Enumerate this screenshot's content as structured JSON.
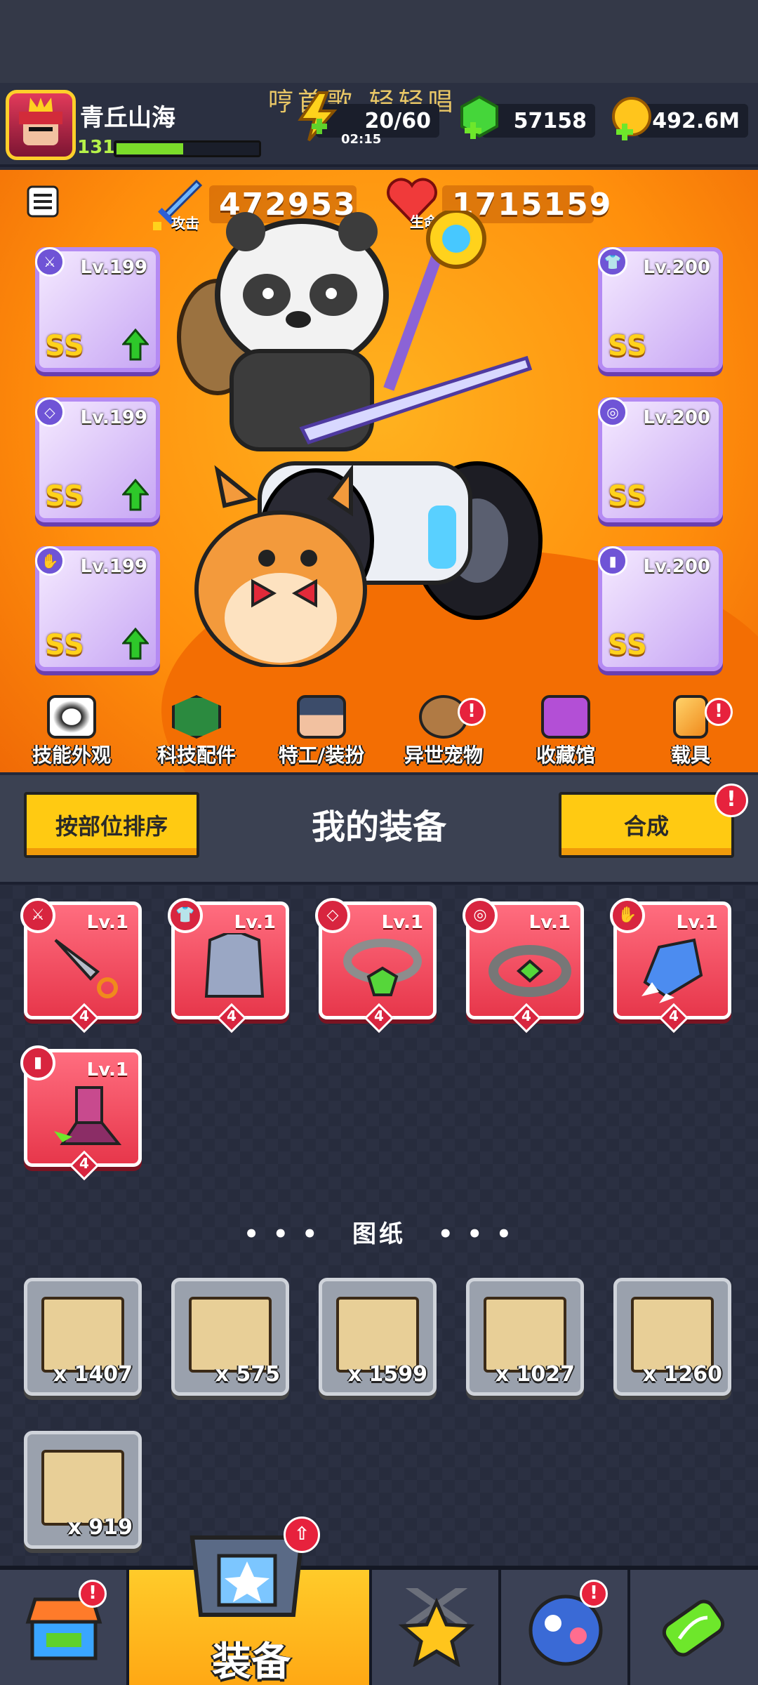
{
  "header": {
    "player_name": "青丘山海",
    "player_level": "131",
    "watermark": "哼首歌 轻轻唱",
    "energy": "20/60",
    "energy_timer": "02:15",
    "gems": "57158",
    "coins": "492.6M"
  },
  "stats": {
    "attack_label": "攻击",
    "attack_value": "472953",
    "hp_label": "生命",
    "hp_value": "1715159"
  },
  "equipped": {
    "left": [
      {
        "level": "Lv.199",
        "grade": "SS",
        "slot_icon": "weapon-icon",
        "upgrade": true
      },
      {
        "level": "Lv.199",
        "grade": "SS",
        "slot_icon": "necklace-icon",
        "upgrade": true
      },
      {
        "level": "Lv.199",
        "grade": "SS",
        "slot_icon": "glove-icon",
        "upgrade": true
      }
    ],
    "right": [
      {
        "level": "Lv.200",
        "grade": "SS",
        "slot_icon": "armor-icon"
      },
      {
        "level": "Lv.200",
        "grade": "SS",
        "slot_icon": "belt-icon"
      },
      {
        "level": "Lv.200",
        "grade": "SS",
        "slot_icon": "boots-icon"
      }
    ]
  },
  "menu": [
    {
      "label": "技能外观",
      "alert": false
    },
    {
      "label": "科技配件",
      "alert": false
    },
    {
      "label": "特工/装扮",
      "alert": false
    },
    {
      "label": "异世宠物",
      "alert": true
    },
    {
      "label": "收藏馆",
      "alert": false
    },
    {
      "label": "载具",
      "alert": true
    }
  ],
  "section": {
    "sort_button": "按部位排序",
    "title": "我的装备",
    "merge_button": "合成",
    "merge_alert": "!"
  },
  "inventory": [
    {
      "level": "Lv.1",
      "count": "4",
      "slot_icon": "weapon-icon"
    },
    {
      "level": "Lv.1",
      "count": "4",
      "slot_icon": "armor-icon"
    },
    {
      "level": "Lv.1",
      "count": "4",
      "slot_icon": "necklace-icon"
    },
    {
      "level": "Lv.1",
      "count": "4",
      "slot_icon": "belt-icon"
    },
    {
      "level": "Lv.1",
      "count": "4",
      "slot_icon": "glove-icon"
    },
    {
      "level": "Lv.1",
      "count": "4",
      "slot_icon": "boots-icon"
    }
  ],
  "blueprints": {
    "title": "图纸",
    "items": [
      {
        "count": "x 1407",
        "icon": "weapon-blueprint-icon"
      },
      {
        "count": "x 575",
        "icon": "armor-blueprint-icon"
      },
      {
        "count": "x 1599",
        "icon": "necklace-blueprint-icon"
      },
      {
        "count": "x 1027",
        "icon": "belt-blueprint-icon"
      },
      {
        "count": "x 1260",
        "icon": "glove-blueprint-icon"
      },
      {
        "count": "x 919",
        "icon": "boots-blueprint-icon"
      }
    ]
  },
  "nav": {
    "shop": "shop-icon",
    "equipment_label": "装备",
    "talent": "star-swords-icon",
    "eggs": "egg-icon",
    "lab": "dna-capsule-icon"
  },
  "colors": {
    "accent_yellow": "#ffca12",
    "hero_orange": "#ff8f0c",
    "card_red": "#e7374b",
    "alert_red": "#e7223d"
  }
}
